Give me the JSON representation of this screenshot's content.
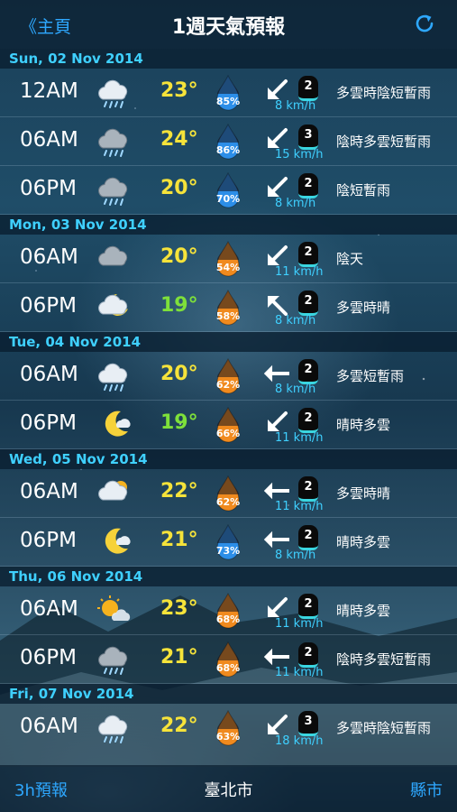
{
  "header": {
    "back_label": "《主頁",
    "title": "1週天氣預報",
    "refresh_icon": "refresh-icon"
  },
  "colors": {
    "accent": "#2ea8ff",
    "day_header": "#3fd0ff",
    "temp_yellow": "#f6e33a",
    "temp_green": "#7ee03a",
    "drop_blue": "#2c8ee8",
    "drop_orange": "#f08a1e"
  },
  "days": [
    {
      "date": "Sun, 02 Nov 2014",
      "rows": [
        {
          "time": "12AM",
          "icon": "cloud-rain",
          "temp": "23°",
          "temp_color": "yellow",
          "drop": "blue",
          "pct": "85%",
          "dir": "sw",
          "level": "2",
          "speed": "8 km/h",
          "desc": "多雲時陰短暫雨"
        },
        {
          "time": "06AM",
          "icon": "cloud-rain-dark",
          "temp": "24°",
          "temp_color": "yellow",
          "drop": "blue",
          "pct": "86%",
          "dir": "sw",
          "level": "3",
          "speed": "15 km/h",
          "desc": "陰時多雲短暫雨"
        },
        {
          "time": "06PM",
          "icon": "cloud-rain-dark",
          "temp": "20°",
          "temp_color": "yellow",
          "drop": "blue",
          "pct": "70%",
          "dir": "sw",
          "level": "2",
          "speed": "8 km/h",
          "desc": "陰短暫雨"
        }
      ]
    },
    {
      "date": "Mon, 03 Nov 2014",
      "rows": [
        {
          "time": "06AM",
          "icon": "cloud-dark",
          "temp": "20°",
          "temp_color": "yellow",
          "drop": "orange",
          "pct": "54%",
          "dir": "sw",
          "level": "2",
          "speed": "11 km/h",
          "desc": "陰天"
        },
        {
          "time": "06PM",
          "icon": "moon-cloud",
          "temp": "19°",
          "temp_color": "green",
          "drop": "orange",
          "pct": "58%",
          "dir": "nw",
          "level": "2",
          "speed": "8 km/h",
          "desc": "多雲時晴"
        }
      ]
    },
    {
      "date": "Tue, 04 Nov 2014",
      "rows": [
        {
          "time": "06AM",
          "icon": "cloud-rain",
          "temp": "20°",
          "temp_color": "yellow",
          "drop": "orange",
          "pct": "62%",
          "dir": "w",
          "level": "2",
          "speed": "8 km/h",
          "desc": "多雲短暫雨"
        },
        {
          "time": "06PM",
          "icon": "moon-cloud-small",
          "temp": "19°",
          "temp_color": "green",
          "drop": "orange",
          "pct": "66%",
          "dir": "sw",
          "level": "2",
          "speed": "11 km/h",
          "desc": "晴時多雲"
        }
      ]
    },
    {
      "date": "Wed, 05 Nov 2014",
      "rows": [
        {
          "time": "06AM",
          "icon": "sun-cloud",
          "temp": "22°",
          "temp_color": "yellow",
          "drop": "orange",
          "pct": "62%",
          "dir": "w",
          "level": "2",
          "speed": "11 km/h",
          "desc": "多雲時晴"
        },
        {
          "time": "06PM",
          "icon": "moon-cloud-small",
          "temp": "21°",
          "temp_color": "yellow",
          "drop": "blue",
          "pct": "73%",
          "dir": "w",
          "level": "2",
          "speed": "8 km/h",
          "desc": "晴時多雲"
        }
      ]
    },
    {
      "date": "Thu, 06 Nov 2014",
      "rows": [
        {
          "time": "06AM",
          "icon": "sun-cloud-small",
          "temp": "23°",
          "temp_color": "yellow",
          "drop": "orange",
          "pct": "68%",
          "dir": "sw",
          "level": "2",
          "speed": "11 km/h",
          "desc": "晴時多雲"
        },
        {
          "time": "06PM",
          "icon": "cloud-rain-dark",
          "temp": "21°",
          "temp_color": "yellow",
          "drop": "orange",
          "pct": "68%",
          "dir": "w",
          "level": "2",
          "speed": "11 km/h",
          "desc": "陰時多雲短暫雨"
        }
      ]
    },
    {
      "date": "Fri, 07 Nov 2014",
      "rows": [
        {
          "time": "06AM",
          "icon": "cloud-rain",
          "temp": "22°",
          "temp_color": "yellow",
          "drop": "orange",
          "pct": "63%",
          "dir": "sw",
          "level": "3",
          "speed": "18 km/h",
          "desc": "多雲時陰短暫雨"
        }
      ]
    }
  ],
  "bottom": {
    "left_label": "3h預報",
    "center_label": "臺北市",
    "right_label": "縣市"
  }
}
